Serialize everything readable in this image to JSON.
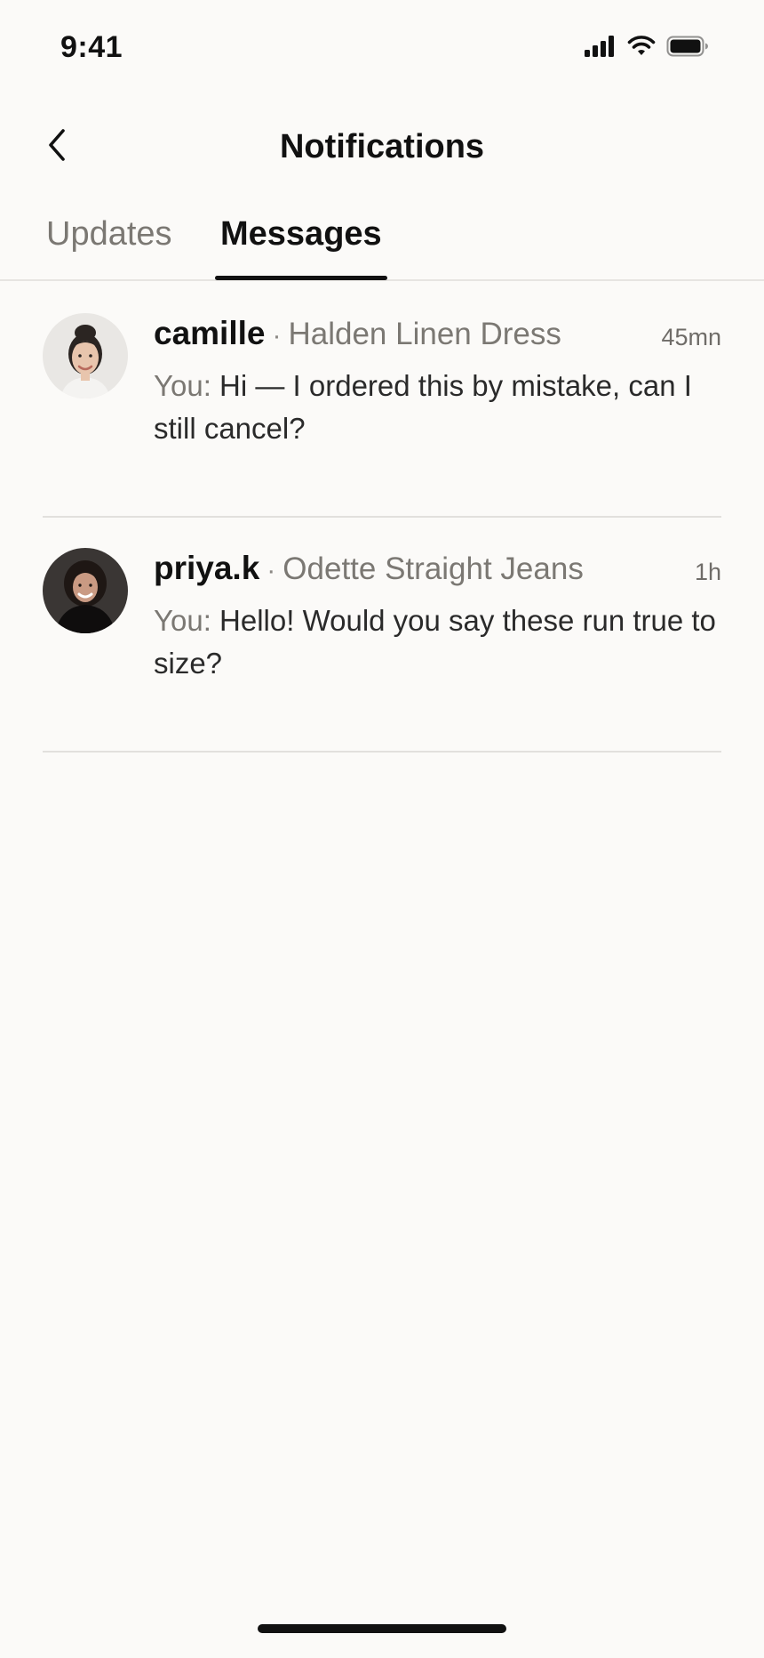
{
  "status_bar": {
    "time": "9:41",
    "icons": [
      "cellular-signal-icon",
      "wifi-icon",
      "battery-icon"
    ]
  },
  "header": {
    "title": "Notifications",
    "back_icon": "chevron-left-icon"
  },
  "tabs": [
    {
      "label": "Updates",
      "active": false
    },
    {
      "label": "Messages",
      "active": true
    }
  ],
  "messages": [
    {
      "name": "camille",
      "separator": "·",
      "product": "Halden Linen Dress",
      "time": "45mn",
      "prefix": "You:",
      "text": "Hi — I ordered this by mistake, can I still cancel?"
    },
    {
      "name": "priya.k",
      "separator": "·",
      "product": "Odette Straight Jeans",
      "time": "1h",
      "prefix": "You:",
      "text": "Hello! Would you say these run true to size?"
    }
  ],
  "colors": {
    "background": "#fbfaf8",
    "primary_text": "#111111",
    "muted_text": "#7b7873",
    "divider": "#e2e0dd"
  }
}
